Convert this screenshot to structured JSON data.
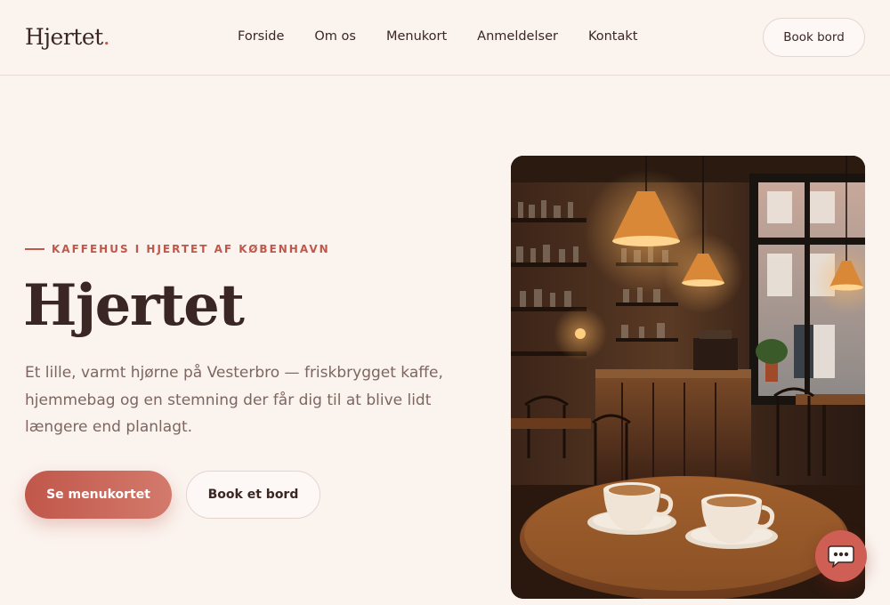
{
  "brand": {
    "name": "Hjertet",
    "dot": ".",
    "accent": "#c0574a"
  },
  "nav": {
    "items": [
      {
        "label": "Forside"
      },
      {
        "label": "Om os"
      },
      {
        "label": "Menukort"
      },
      {
        "label": "Anmeldelser"
      },
      {
        "label": "Kontakt"
      }
    ],
    "cta_label": "Book bord"
  },
  "hero": {
    "eyebrow": "KAFFEHUS I HJERTET AF KØBENHAVN",
    "title": "Hjertet",
    "description": "Et lille, varmt hjørne på Vesterbro — friskbrygget kaffe, hjemmebag og en stemning der får dig til at blive lidt længere end planlagt.",
    "primary_button": "Se menukortet",
    "secondary_button": "Book et bord",
    "image_icon": "cafe-interior-photo"
  },
  "chat": {
    "icon": "chat-bubble-icon",
    "color": "#cf5f55"
  }
}
